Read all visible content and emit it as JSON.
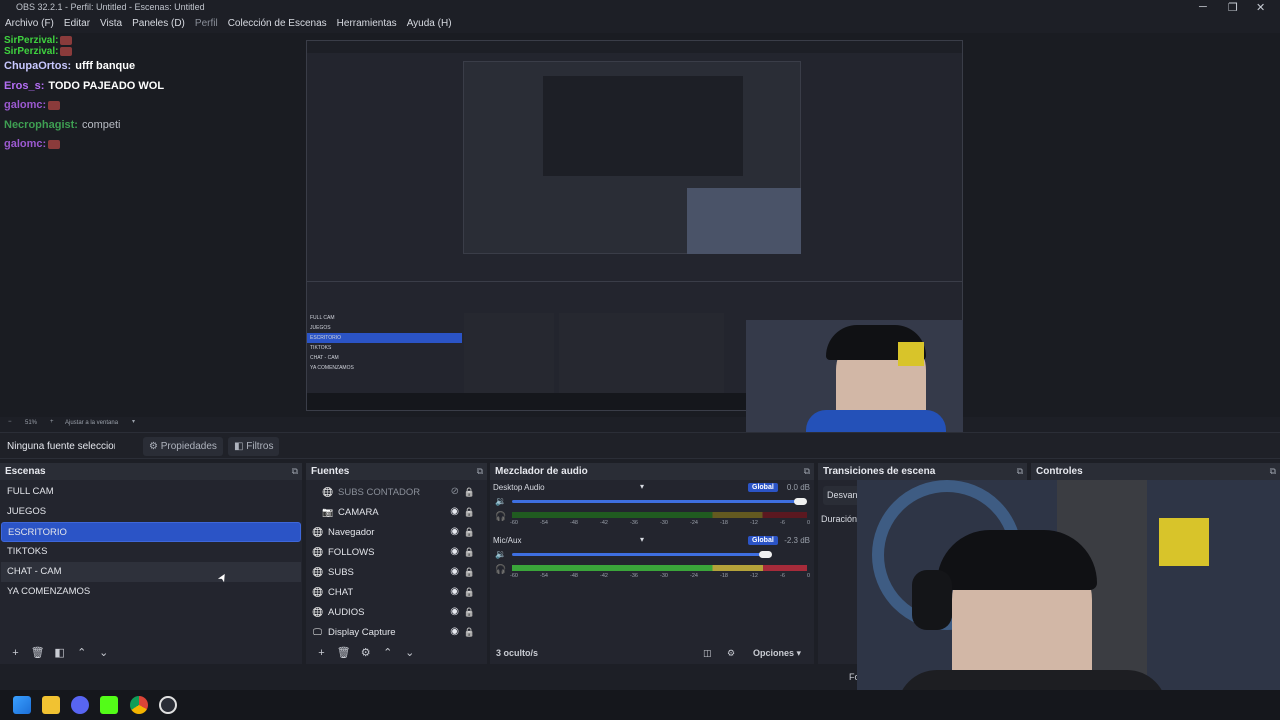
{
  "window": {
    "title": "OBS 32.2.1 - Perfil: Untitled - Escenas: Untitled"
  },
  "menu": [
    "Archivo (F)",
    "Editar",
    "Vista",
    "Paneles (D)",
    "Perfil",
    "Colección de Escenas",
    "Herramientas",
    "Ayuda (H)"
  ],
  "chat": [
    {
      "user": "SirPerzival:",
      "text": "",
      "color": "#3fd23f",
      "emote": true
    },
    {
      "user": "SirPerzival:",
      "text": "",
      "color": "#3fd23f",
      "emote": true
    },
    {
      "user": "ChupaOrtos:",
      "text": "ufff banque",
      "color": "#c8c8ff",
      "emote": false
    },
    {
      "user": "Eros_s:",
      "text": "TODO PAJEADO WOL",
      "color": "#b46ef5",
      "emote": false
    },
    {
      "user": "galomc:",
      "text": "",
      "color": "#9b59d0",
      "emote": true
    },
    {
      "user": "Necrophagist:",
      "text": "competi",
      "color": "#3e9f52",
      "emote": false
    },
    {
      "user": "galomc:",
      "text": "",
      "color": "#9b59d0",
      "emote": true
    }
  ],
  "zoom": {
    "percent": "51%",
    "fit_label": "Ajustar a la ventana"
  },
  "source_bar": {
    "selection": "Ninguna fuente seleccionada",
    "properties": "Propiedades",
    "filters": "Filtros"
  },
  "scenes": {
    "title": "Escenas",
    "items": [
      "FULL CAM",
      "JUEGOS",
      "ESCRITORIO",
      "TIKTOKS",
      "CHAT - CAM",
      "YA COMENZAMOS"
    ],
    "selected_index": 2
  },
  "sources": {
    "title": "Fuentes",
    "items": [
      {
        "name": "SUBS CONTADOR",
        "icon": "globe-icon",
        "visible": false,
        "indent": true
      },
      {
        "name": "CAMARA",
        "icon": "camera-icon",
        "visible": true,
        "indent": true
      },
      {
        "name": "Navegador",
        "icon": "globe-icon",
        "visible": true,
        "indent": false
      },
      {
        "name": "FOLLOWS",
        "icon": "globe-icon",
        "visible": true,
        "indent": false
      },
      {
        "name": "SUBS",
        "icon": "globe-icon",
        "visible": true,
        "indent": false
      },
      {
        "name": "CHAT",
        "icon": "globe-icon",
        "visible": true,
        "indent": false
      },
      {
        "name": "AUDIOS",
        "icon": "globe-icon",
        "visible": true,
        "indent": false
      },
      {
        "name": "Display Capture",
        "icon": "monitor-icon",
        "visible": true,
        "indent": false
      }
    ]
  },
  "mixer": {
    "title": "Mezclador de audio",
    "channels": [
      {
        "name": "Desktop Audio",
        "db": "0.0 dB",
        "badge": "Global",
        "fader_percent": 100
      },
      {
        "name": "Mic/Aux",
        "db": "-2.3 dB",
        "badge": "Global",
        "fader_percent": 88
      }
    ],
    "ticks": [
      "-60",
      "-54",
      "-48",
      "-42",
      "-36",
      "-30",
      "-24",
      "-18",
      "-12",
      "-6",
      "0"
    ],
    "hidden": "3 oculto/s",
    "options": "Opciones"
  },
  "transitions": {
    "title": "Transiciones de escena",
    "current": "Desvane",
    "duration_label": "Duración"
  },
  "controls": {
    "title": "Controles",
    "partial_label": "Fo"
  },
  "icons": {
    "add": "+",
    "remove": "🗑",
    "filter": "⚙",
    "up": "⌃",
    "down": "⌄",
    "eye": "👁",
    "lock": "🔒",
    "speaker": "🔊",
    "gear": "⚙"
  },
  "colors": {
    "accent": "#2b54c6",
    "panel": "#23252e",
    "header": "#2a2d36"
  }
}
